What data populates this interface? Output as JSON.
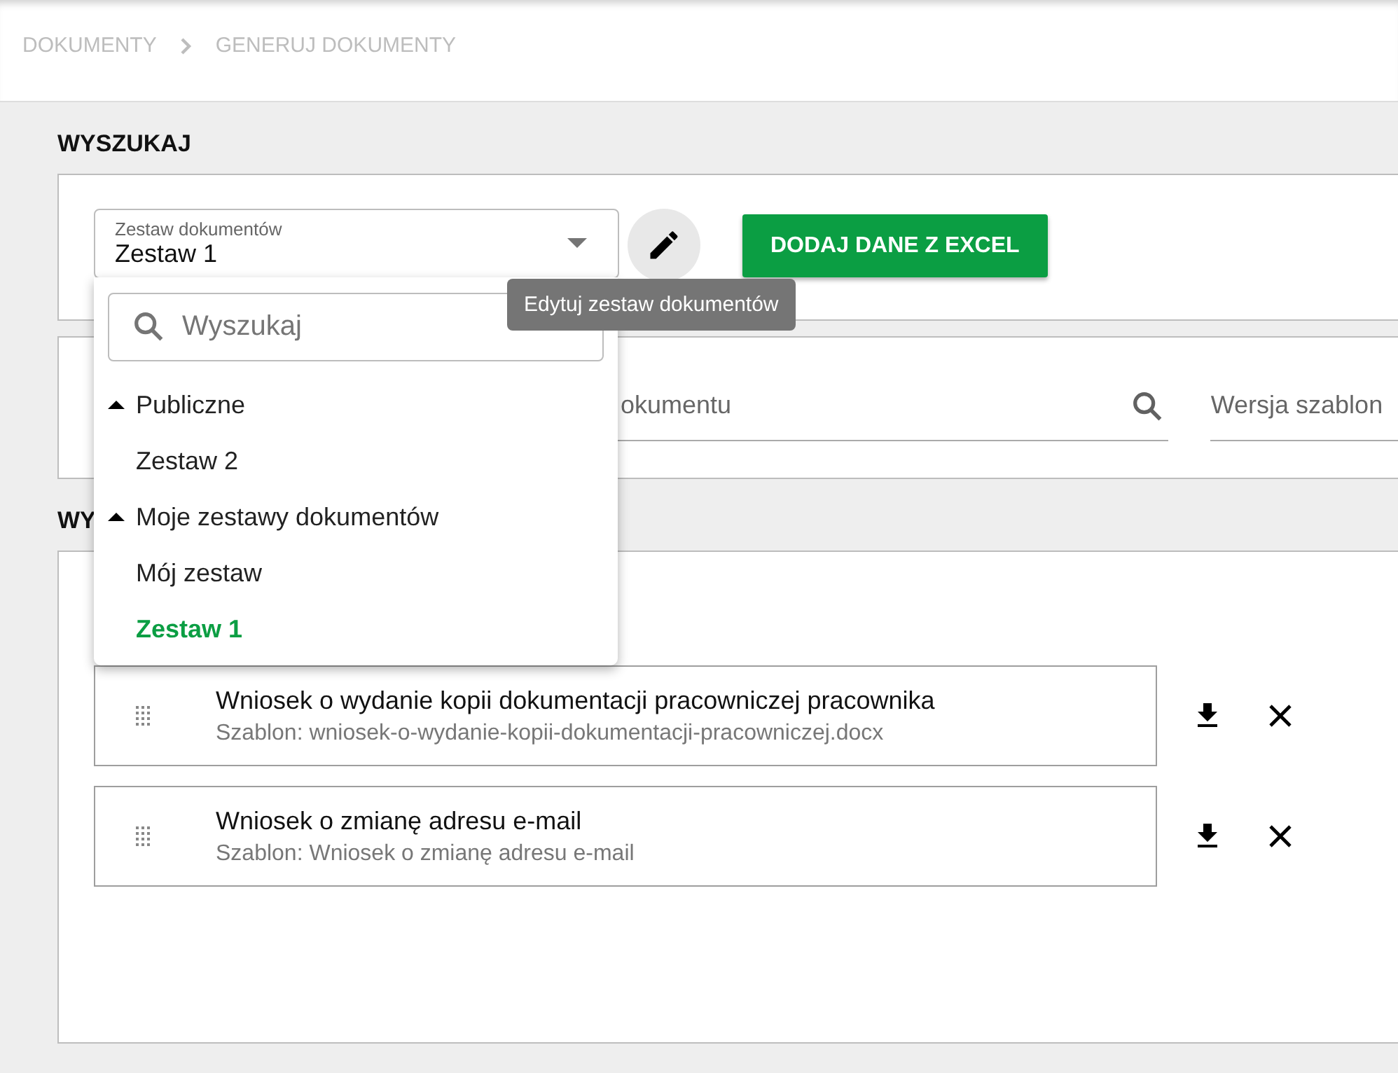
{
  "breadcrumb": [
    {
      "label": "DOKUMENTY"
    },
    {
      "label": "GENERUJ DOKUMENTY"
    }
  ],
  "search_section": {
    "heading": "WYSZUKAJ",
    "set_select": {
      "label": "Zestaw dokumentów",
      "value": "Zestaw 1",
      "expanded": true
    },
    "edit_tooltip": "Edytuj zestaw dokumentów",
    "excel_button": "DODAJ DANE Z EXCEL"
  },
  "filters": [
    {
      "kind": "search",
      "placeholder": "okumentu"
    },
    {
      "kind": "plain",
      "placeholder": "Wersja szablon"
    }
  ],
  "dropdown": {
    "search_placeholder": "Wyszukaj",
    "groups": [
      {
        "label": "Publiczne",
        "expanded": true,
        "children": [
          {
            "label": "Zestaw 2",
            "selected": false
          }
        ]
      },
      {
        "label": "Moje zestawy dokumentów",
        "expanded": true,
        "children": [
          {
            "label": "Mój zestaw",
            "selected": false
          },
          {
            "label": "Zestaw 1",
            "selected": true
          }
        ]
      }
    ]
  },
  "results_section": {
    "heading": "WY"
  },
  "documents": [
    {
      "title": "Wniosek o wydanie kopii dokumentacji pracowniczej pracownika",
      "template": "Szablon: wniosek-o-wydanie-kopii-dokumentacji-pracowniczej.docx"
    },
    {
      "title": "Wniosek o zmianę adresu e-mail",
      "template": "Szablon: Wniosek o zmianę adresu e-mail"
    }
  ]
}
